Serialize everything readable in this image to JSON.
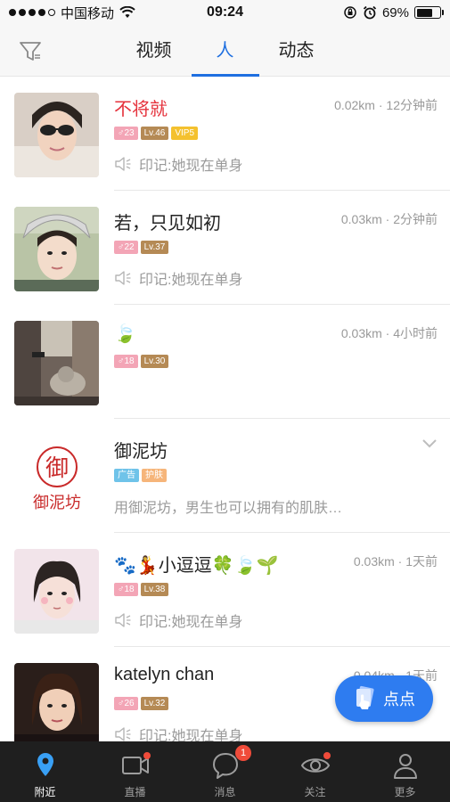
{
  "status_bar": {
    "carrier": "中国移动",
    "time": "09:24",
    "battery_text": "69%",
    "battery_level": 0.69
  },
  "header": {
    "tabs": [
      {
        "label": "视频",
        "active": false
      },
      {
        "label": "人",
        "active": true
      },
      {
        "label": "动态",
        "active": false
      }
    ]
  },
  "list": [
    {
      "name": "不将就",
      "meta": "0.02km · 12分钟前",
      "age": "♂23",
      "level": "Lv.46",
      "vip": "VIP5",
      "note": "印记:她现在单身"
    },
    {
      "name": "若，只见如初",
      "meta": "0.03km · 2分钟前",
      "age": "♂22",
      "level": "Lv.37",
      "note": "印记:她现在单身"
    },
    {
      "name": "🍃",
      "meta": "0.03km · 4小时前",
      "age": "♂18",
      "level": "Lv.30"
    },
    {
      "name": "御泥坊",
      "tag_ad": "广告",
      "tag_skin": "护肤",
      "desc": "用御泥坊，男生也可以拥有的肌肤…",
      "logo_char": "御",
      "logo_text": "御泥坊"
    },
    {
      "name": "🐾💃小逗逗🍀🍃🌱",
      "meta": "0.03km · 1天前",
      "age": "♂18",
      "level": "Lv.38",
      "note": "印记:她现在单身"
    },
    {
      "name": "katelyn chan",
      "meta": "0.04km · 1天前",
      "age": "♂26",
      "level": "Lv.32",
      "note": "印记:她现在单身"
    }
  ],
  "float_button": {
    "label": "点点"
  },
  "tabbar": {
    "items": [
      {
        "label": "附近",
        "active": true
      },
      {
        "label": "直播"
      },
      {
        "label": "消息",
        "badge": "1"
      },
      {
        "label": "关注"
      },
      {
        "label": "更多"
      }
    ]
  },
  "colors": {
    "accent": "#1e6fe0",
    "red_name": "#e5323c",
    "tabbar_bg": "#1f1f1f",
    "float_btn": "#2e7cf0"
  }
}
